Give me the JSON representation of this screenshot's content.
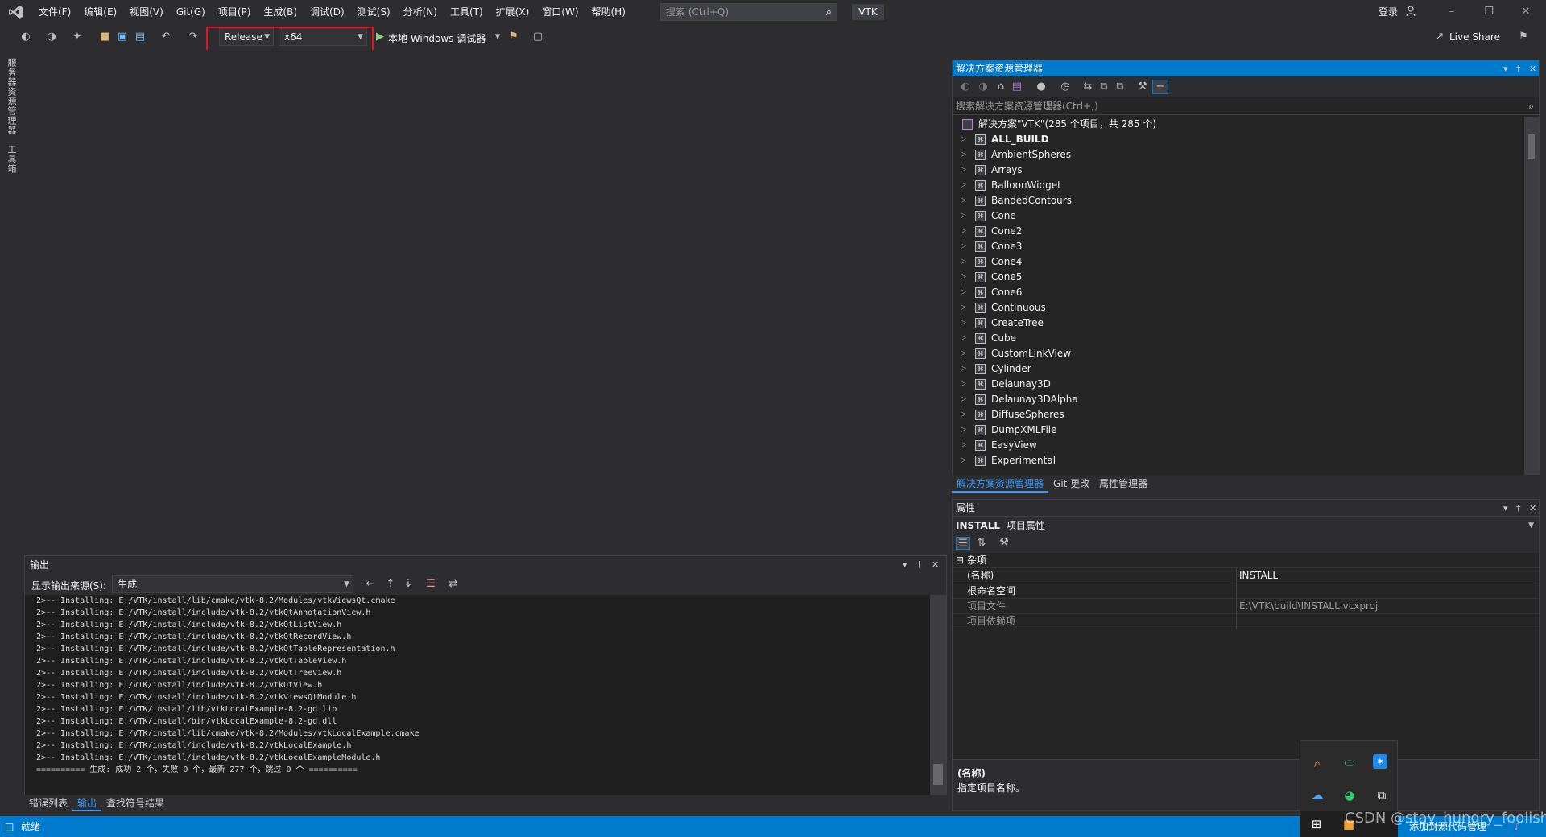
{
  "menu": {
    "items": [
      "文件(F)",
      "编辑(E)",
      "视图(V)",
      "Git(G)",
      "项目(P)",
      "生成(B)",
      "调试(D)",
      "测试(S)",
      "分析(N)",
      "工具(T)",
      "扩展(X)",
      "窗口(W)",
      "帮助(H)"
    ],
    "search_placeholder": "搜索 (Ctrl+Q)",
    "solution_name": "VTK",
    "login": "登录"
  },
  "toolbar": {
    "config": "Release",
    "platform": "x64",
    "run_label": "本地 Windows 调试器",
    "live_share": "Live Share"
  },
  "left_rail": {
    "tab1": "服务器资源管理器",
    "tab2": "工具箱"
  },
  "output": {
    "title": "输出",
    "source_label": "显示输出来源(S):",
    "source_value": "生成",
    "lines": [
      "2>-- Installing: E:/VTK/install/lib/cmake/vtk-8.2/Modules/vtkViewsQt.cmake",
      "2>-- Installing: E:/VTK/install/include/vtk-8.2/vtkQtAnnotationView.h",
      "2>-- Installing: E:/VTK/install/include/vtk-8.2/vtkQtListView.h",
      "2>-- Installing: E:/VTK/install/include/vtk-8.2/vtkQtRecordView.h",
      "2>-- Installing: E:/VTK/install/include/vtk-8.2/vtkQtTableRepresentation.h",
      "2>-- Installing: E:/VTK/install/include/vtk-8.2/vtkQtTableView.h",
      "2>-- Installing: E:/VTK/install/include/vtk-8.2/vtkQtTreeView.h",
      "2>-- Installing: E:/VTK/install/include/vtk-8.2/vtkQtView.h",
      "2>-- Installing: E:/VTK/install/include/vtk-8.2/vtkViewsQtModule.h",
      "2>-- Installing: E:/VTK/install/lib/vtkLocalExample-8.2-gd.lib",
      "2>-- Installing: E:/VTK/install/bin/vtkLocalExample-8.2-gd.dll",
      "2>-- Installing: E:/VTK/install/lib/cmake/vtk-8.2/Modules/vtkLocalExample.cmake",
      "2>-- Installing: E:/VTK/install/include/vtk-8.2/vtkLocalExample.h",
      "2>-- Installing: E:/VTK/install/include/vtk-8.2/vtkLocalExampleModule.h",
      "========== 生成: 成功 2 个，失败 0 个，最新 277 个，跳过 0 个 =========="
    ]
  },
  "bottom_tabs": [
    "错误列表",
    "输出",
    "查找符号结果"
  ],
  "solution_explorer": {
    "title": "解决方案资源管理器",
    "search_placeholder": "搜索解决方案资源管理器(Ctrl+;)",
    "root": "解决方案\"VTK\"(285 个项目，共 285 个)",
    "items": [
      "ALL_BUILD",
      "AmbientSpheres",
      "Arrays",
      "BalloonWidget",
      "BandedContours",
      "Cone",
      "Cone2",
      "Cone3",
      "Cone4",
      "Cone5",
      "Cone6",
      "Continuous",
      "CreateTree",
      "Cube",
      "CustomLinkView",
      "Cylinder",
      "Delaunay3D",
      "Delaunay3DAlpha",
      "DiffuseSpheres",
      "DumpXMLFile",
      "EasyView",
      "Experimental"
    ],
    "tabs": [
      "解决方案资源管理器",
      "Git 更改",
      "属性管理器"
    ]
  },
  "properties": {
    "title": "属性",
    "object_name": "INSTALL",
    "object_kind": "项目属性",
    "category": "杂项",
    "rows": [
      {
        "key": "(名称)",
        "value": "INSTALL"
      },
      {
        "key": "根命名空间",
        "value": ""
      },
      {
        "key": "项目文件",
        "value": "E:\\VTK\\build\\INSTALL.vcxproj"
      },
      {
        "key": "项目依赖项",
        "value": ""
      }
    ],
    "desc_title": "(名称)",
    "desc_text": "指定项目名称。"
  },
  "status": {
    "ready": "就绪",
    "right_text": "添加到源代码管理"
  },
  "watermark": "CSDN @stay_hungry_foolish",
  "colors": {
    "accent": "#007acc",
    "highlight": "#e81123",
    "background": "#2d2d30"
  }
}
